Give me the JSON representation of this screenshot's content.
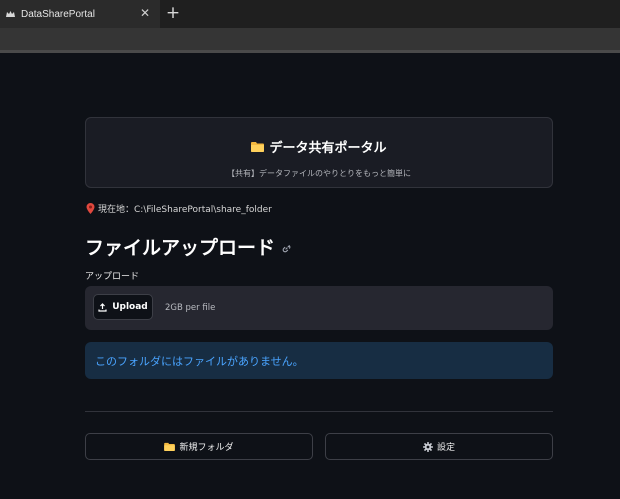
{
  "browser": {
    "tab_title": "DataSharePortal",
    "close_glyph": "✕",
    "newtab_glyph": "+"
  },
  "header": {
    "title": "データ共有ポータル",
    "subtitle": "【共有】データファイルのやりとりをもっと簡単に"
  },
  "location": {
    "text": "現在地：C:\\FileSharePortal\\share_folder"
  },
  "section": {
    "title": "ファイルアップロード"
  },
  "uploader": {
    "label": "アップロード",
    "button_label": "Upload",
    "limit_text": "2GB per file"
  },
  "info": {
    "message": "このフォルダにはファイルがありません。"
  },
  "actions": {
    "new_folder_label": "新規フォルダ",
    "settings_label": "設定"
  },
  "colors": {
    "background": "#0e1117",
    "card": "#1a1c24",
    "info_bg": "#172d43",
    "info_text": "#4aa4ff"
  }
}
